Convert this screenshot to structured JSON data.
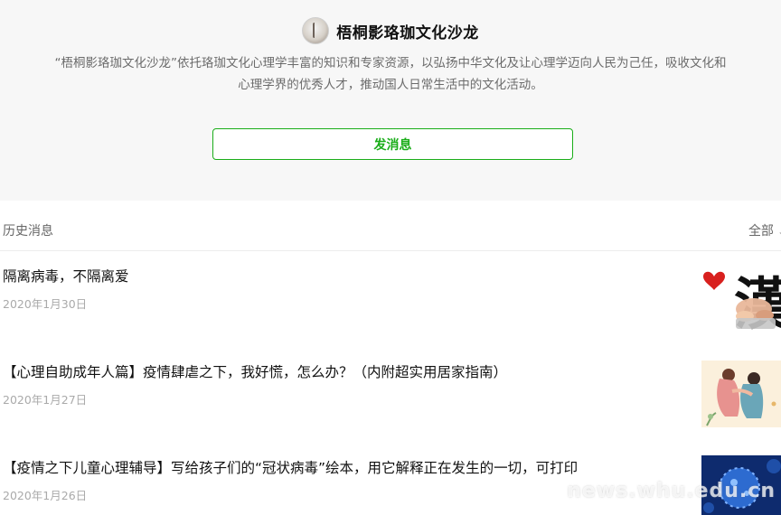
{
  "profile": {
    "name": "梧桐影珞珈文化沙龙",
    "description_line1": "“梧桐影珞珈文化沙龙”依托珞珈文化心理学丰富的知识和专家资源，以弘扬中华文化及让心理学迈向人民为己任，吸收文化和",
    "description_line2": "心理学界的优秀人才，推动国人日常生活中的文化活动。",
    "send_button": "发消息"
  },
  "history": {
    "label": "历史消息",
    "filter": "全部"
  },
  "articles": [
    {
      "title": "隔离病毒，不隔离爱",
      "date": "2020年1月30日",
      "thumb_char": "漢"
    },
    {
      "title": "【心理自助成年人篇】疫情肆虐之下，我好慌，怎么办？（内附超实用居家指南）",
      "date": "2020年1月27日"
    },
    {
      "title": "【疫情之下儿童心理辅导】写给孩子们的“冠状病毒”绘本，用它解释正在发生的一切，可打印",
      "date": "2020年1月26日"
    }
  ],
  "watermark": "news.whu.edu.cn",
  "colors": {
    "accent": "#1aad19",
    "profile_bg": "#f7f7f7"
  }
}
